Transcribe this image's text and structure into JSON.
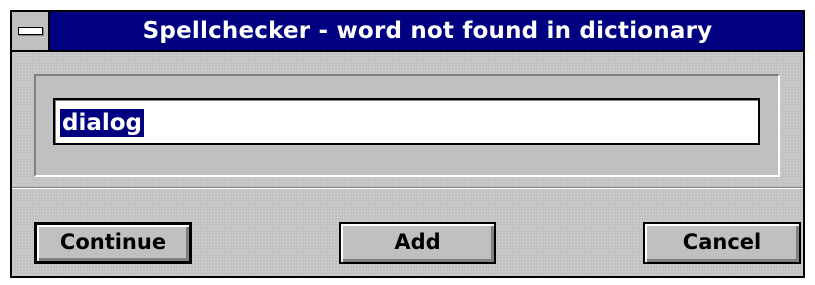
{
  "window": {
    "title": "Spellchecker - word not found in dictionary"
  },
  "word_field": {
    "value": "dialog",
    "selected": true
  },
  "buttons": {
    "continue_label": "Continue",
    "add_label": "Add",
    "cancel_label": "Cancel"
  },
  "colors": {
    "titlebar": "#000080",
    "selection": "#000080",
    "face": "#c0c0c0"
  }
}
